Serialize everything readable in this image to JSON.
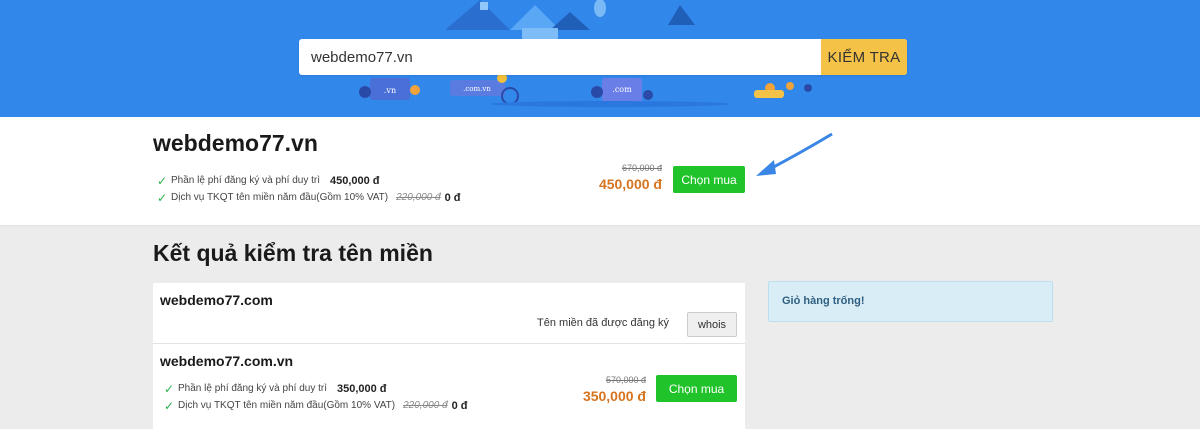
{
  "search": {
    "value": "webdemo77.vn",
    "button_label": "KIỂM TRA"
  },
  "hero_art": {
    "tag_1": ".vn",
    "tag_2": ".com.vn",
    "tag_3": ".com"
  },
  "featured": {
    "domain": "webdemo77.vn",
    "features": [
      {
        "label": "Phần lệ phí đăng ký và phí duy trì",
        "value": "450,000 đ"
      },
      {
        "label": "Dịch vụ TKQT tên miền năm đầu(Gồm 10% VAT)",
        "old_value": "220,000 đ",
        "value": "0 đ"
      }
    ],
    "price_old": "670,000 đ",
    "price_new": "450,000 đ",
    "buy_label": "Chọn mua"
  },
  "results": {
    "title": "Kết quả kiểm tra tên miền",
    "items": [
      {
        "domain": "webdemo77.com",
        "status": "Tên miền đã được đăng ký",
        "whois_label": "whois"
      },
      {
        "domain": "webdemo77.com.vn",
        "features": [
          {
            "label": "Phần lệ phí đăng ký và phí duy trì",
            "value": "350,000 đ"
          },
          {
            "label": "Dịch vụ TKQT tên miền năm đầu(Gồm 10% VAT)",
            "old_value": "220,000 đ",
            "value": "0 đ"
          }
        ],
        "price_old": "570,000 đ",
        "price_new": "350,000 đ",
        "buy_label": "Chọn mua"
      }
    ]
  },
  "cart": {
    "label": "Giỏ hàng trống!"
  },
  "colors": {
    "hero_bg": "#3287eb",
    "search_button": "#f4c247",
    "buy_button": "#21c32a",
    "price": "#d6741f",
    "cart_bg": "#d9edf7"
  }
}
